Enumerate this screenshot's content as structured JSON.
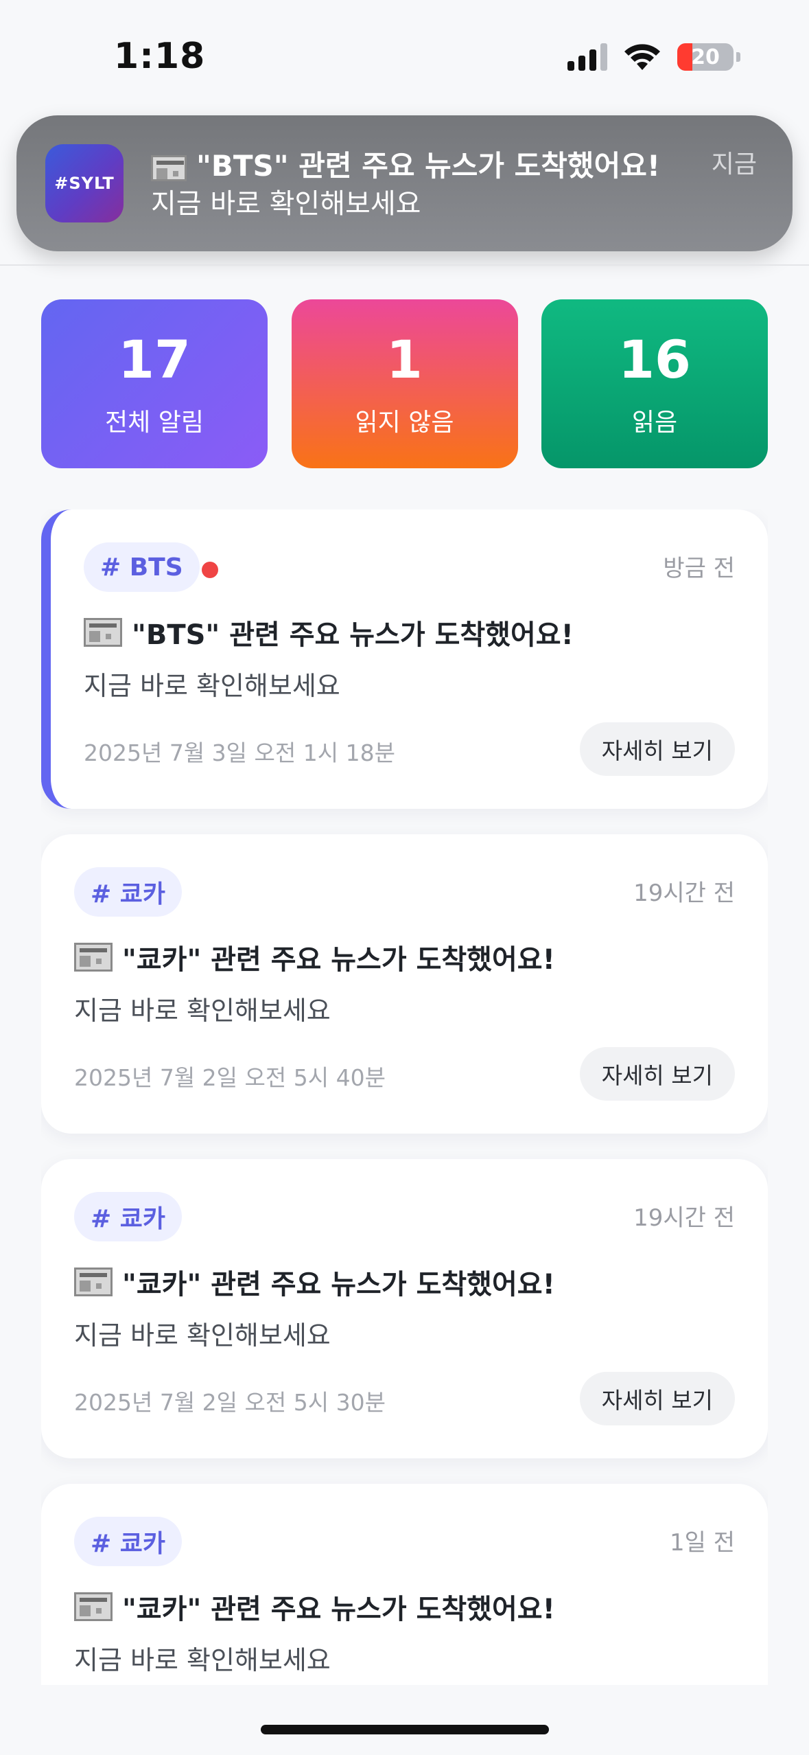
{
  "status_bar": {
    "time": "1:18",
    "battery": "20"
  },
  "banner": {
    "app_icon_text": "#SYLT",
    "title": "\"BTS\" 관련 주요 뉴스가 도착했어요!",
    "body": "지금 바로 확인해보세요",
    "time": "지금"
  },
  "stats": [
    {
      "value": "17",
      "label": "전체 알림"
    },
    {
      "value": "1",
      "label": "읽지 않음"
    },
    {
      "value": "16",
      "label": "읽음"
    }
  ],
  "notifications": [
    {
      "tag": "# BTS",
      "time_ago": "방금 전",
      "title": "\"BTS\" 관련 주요 뉴스가 도착했어요!",
      "body": "지금 바로 확인해보세요",
      "date": "2025년 7월 3일 오전 1시 18분",
      "button": "자세히 보기",
      "unread": true
    },
    {
      "tag": "# 쿄카",
      "time_ago": "19시간 전",
      "title": "\"쿄카\" 관련 주요 뉴스가 도착했어요!",
      "body": "지금 바로 확인해보세요",
      "date": "2025년 7월 2일 오전 5시 40분",
      "button": "자세히 보기",
      "unread": false
    },
    {
      "tag": "# 쿄카",
      "time_ago": "19시간 전",
      "title": "\"쿄카\" 관련 주요 뉴스가 도착했어요!",
      "body": "지금 바로 확인해보세요",
      "date": "2025년 7월 2일 오전 5시 30분",
      "button": "자세히 보기",
      "unread": false
    },
    {
      "tag": "# 쿄카",
      "time_ago": "1일 전",
      "title": "\"쿄카\" 관련 주요 뉴스가 도착했어요!",
      "body": "지금 바로 확인해보세요",
      "date": "",
      "button": "",
      "unread": false
    }
  ],
  "colors": {
    "accent": "#6366f1",
    "unread_dot": "#ef4444"
  }
}
